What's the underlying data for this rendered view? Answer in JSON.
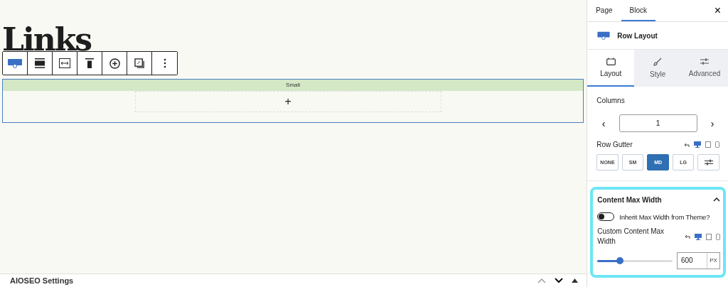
{
  "heading": "Links",
  "toolbar": [
    {
      "kind": "row-layout",
      "selected": true
    },
    {
      "kind": "align"
    },
    {
      "kind": "width"
    },
    {
      "kind": "valign"
    },
    {
      "kind": "add"
    },
    {
      "kind": "copy"
    },
    {
      "kind": "more"
    }
  ],
  "row_block": {
    "label": "Small",
    "add": "+"
  },
  "bottom_panel": {
    "title": "AIOSEO Settings"
  },
  "sidebar": {
    "tabs": [
      {
        "label": "Page",
        "selected": false
      },
      {
        "label": "Block",
        "selected": true
      }
    ],
    "close": "×",
    "block_title": "Row Layout",
    "inspector_tabs": [
      {
        "label": "Layout",
        "kind": "layout",
        "selected": true
      },
      {
        "label": "Style",
        "kind": "style",
        "selected": false
      },
      {
        "label": "Advanced",
        "kind": "advanced",
        "selected": false
      }
    ],
    "columns": {
      "label": "Columns",
      "value": "1",
      "prev": "‹",
      "next": "›"
    },
    "row_gutter": {
      "label": "Row Gutter",
      "options": [
        {
          "label": "NONE",
          "kind": "text",
          "selected": false
        },
        {
          "label": "SM",
          "kind": "text",
          "selected": false
        },
        {
          "label": "MD",
          "kind": "text",
          "selected": true
        },
        {
          "label": "LG",
          "kind": "text",
          "selected": false
        },
        {
          "kind": "custom",
          "selected": false
        }
      ]
    },
    "content_max_width": {
      "title": "Content Max Width",
      "expanded": true,
      "highlighted": true,
      "inherit": {
        "label": "Inherit Max Width from Theme?",
        "on": false
      },
      "custom": {
        "label": "Custom Content Max Width",
        "level": 0.3,
        "value": "600",
        "unit": "PX"
      }
    }
  }
}
